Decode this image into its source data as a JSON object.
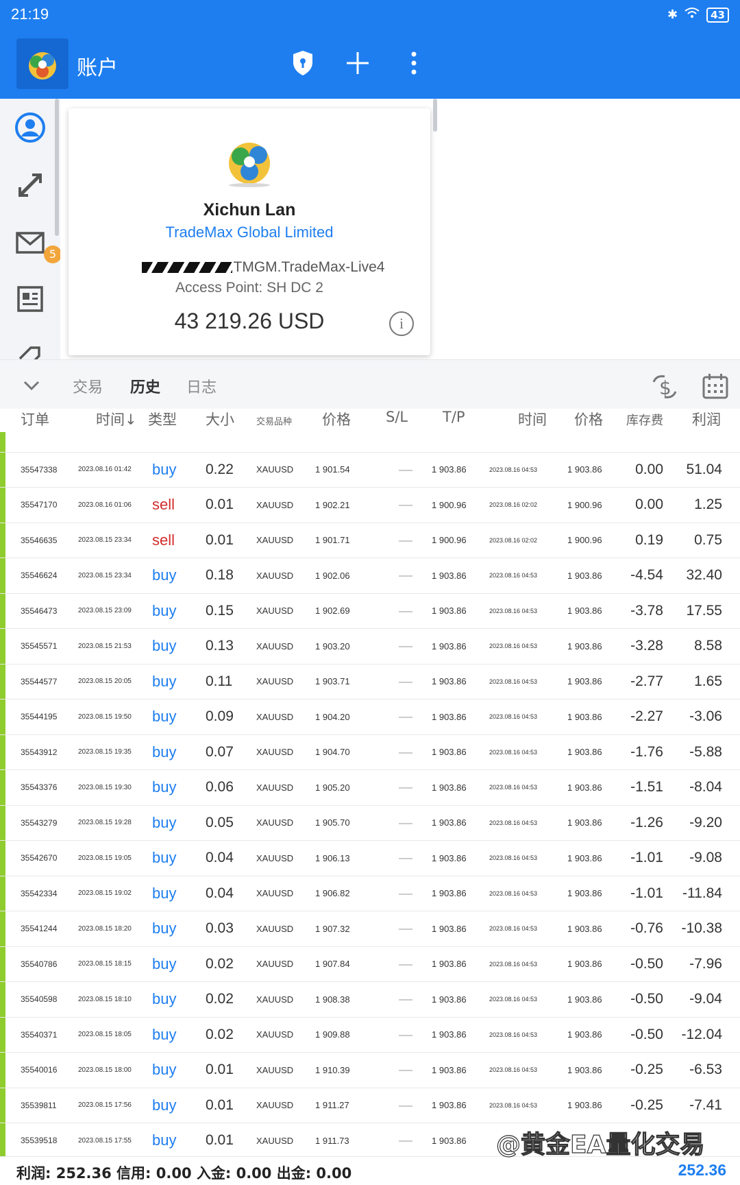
{
  "status": {
    "time": "21:19",
    "battery": "43"
  },
  "app": {
    "title": "账户"
  },
  "account": {
    "name": "Xichun Lan",
    "broker": "TradeMax Global Limited",
    "server": "TMGM.TradeMax-Live4",
    "access_point": "Access Point: SH DC 2",
    "balance": "43 219.26 USD"
  },
  "rail": {
    "mail_badge": "5"
  },
  "tabs": {
    "trade": "交易",
    "history": "历史",
    "journal": "日志"
  },
  "columns": {
    "order": "订单",
    "time": "时间↓",
    "type": "类型",
    "volume": "大小",
    "symbol": "交易品种",
    "price": "价格",
    "sl": "S/L",
    "tp": "T/P",
    "close_time": "时间",
    "close_price": "价格",
    "swap": "库存费",
    "profit": "利润"
  },
  "rows": [
    {
      "order": "35547338",
      "time": "2023.08.16 01:42",
      "type": "buy",
      "volume": "0.22",
      "symbol": "XAUUSD",
      "price": "1 901.54",
      "tp": "1 903.86",
      "close_time": "2023.08.16 04:53",
      "close_price": "1 903.86",
      "swap": "0.00",
      "profit": "51.04"
    },
    {
      "order": "35547170",
      "time": "2023.08.16 01:06",
      "type": "sell",
      "volume": "0.01",
      "symbol": "XAUUSD",
      "price": "1 902.21",
      "tp": "1 900.96",
      "close_time": "2023.08.16 02:02",
      "close_price": "1 900.96",
      "swap": "0.00",
      "profit": "1.25"
    },
    {
      "order": "35546635",
      "time": "2023.08.15 23:34",
      "type": "sell",
      "volume": "0.01",
      "symbol": "XAUUSD",
      "price": "1 901.71",
      "tp": "1 900.96",
      "close_time": "2023.08.16 02:02",
      "close_price": "1 900.96",
      "swap": "0.19",
      "profit": "0.75"
    },
    {
      "order": "35546624",
      "time": "2023.08.15 23:34",
      "type": "buy",
      "volume": "0.18",
      "symbol": "XAUUSD",
      "price": "1 902.06",
      "tp": "1 903.86",
      "close_time": "2023.08.16 04:53",
      "close_price": "1 903.86",
      "swap": "-4.54",
      "profit": "32.40"
    },
    {
      "order": "35546473",
      "time": "2023.08.15 23:09",
      "type": "buy",
      "volume": "0.15",
      "symbol": "XAUUSD",
      "price": "1 902.69",
      "tp": "1 903.86",
      "close_time": "2023.08.16 04:53",
      "close_price": "1 903.86",
      "swap": "-3.78",
      "profit": "17.55"
    },
    {
      "order": "35545571",
      "time": "2023.08.15 21:53",
      "type": "buy",
      "volume": "0.13",
      "symbol": "XAUUSD",
      "price": "1 903.20",
      "tp": "1 903.86",
      "close_time": "2023.08.16 04:53",
      "close_price": "1 903.86",
      "swap": "-3.28",
      "profit": "8.58"
    },
    {
      "order": "35544577",
      "time": "2023.08.15 20:05",
      "type": "buy",
      "volume": "0.11",
      "symbol": "XAUUSD",
      "price": "1 903.71",
      "tp": "1 903.86",
      "close_time": "2023.08.16 04:53",
      "close_price": "1 903.86",
      "swap": "-2.77",
      "profit": "1.65"
    },
    {
      "order": "35544195",
      "time": "2023.08.15 19:50",
      "type": "buy",
      "volume": "0.09",
      "symbol": "XAUUSD",
      "price": "1 904.20",
      "tp": "1 903.86",
      "close_time": "2023.08.16 04:53",
      "close_price": "1 903.86",
      "swap": "-2.27",
      "profit": "-3.06"
    },
    {
      "order": "35543912",
      "time": "2023.08.15 19:35",
      "type": "buy",
      "volume": "0.07",
      "symbol": "XAUUSD",
      "price": "1 904.70",
      "tp": "1 903.86",
      "close_time": "2023.08.16 04:53",
      "close_price": "1 903.86",
      "swap": "-1.76",
      "profit": "-5.88"
    },
    {
      "order": "35543376",
      "time": "2023.08.15 19:30",
      "type": "buy",
      "volume": "0.06",
      "symbol": "XAUUSD",
      "price": "1 905.20",
      "tp": "1 903.86",
      "close_time": "2023.08.16 04:53",
      "close_price": "1 903.86",
      "swap": "-1.51",
      "profit": "-8.04"
    },
    {
      "order": "35543279",
      "time": "2023.08.15 19:28",
      "type": "buy",
      "volume": "0.05",
      "symbol": "XAUUSD",
      "price": "1 905.70",
      "tp": "1 903.86",
      "close_time": "2023.08.16 04:53",
      "close_price": "1 903.86",
      "swap": "-1.26",
      "profit": "-9.20"
    },
    {
      "order": "35542670",
      "time": "2023.08.15 19:05",
      "type": "buy",
      "volume": "0.04",
      "symbol": "XAUUSD",
      "price": "1 906.13",
      "tp": "1 903.86",
      "close_time": "2023.08.16 04:53",
      "close_price": "1 903.86",
      "swap": "-1.01",
      "profit": "-9.08"
    },
    {
      "order": "35542334",
      "time": "2023.08.15 19:02",
      "type": "buy",
      "volume": "0.04",
      "symbol": "XAUUSD",
      "price": "1 906.82",
      "tp": "1 903.86",
      "close_time": "2023.08.16 04:53",
      "close_price": "1 903.86",
      "swap": "-1.01",
      "profit": "-11.84"
    },
    {
      "order": "35541244",
      "time": "2023.08.15 18:20",
      "type": "buy",
      "volume": "0.03",
      "symbol": "XAUUSD",
      "price": "1 907.32",
      "tp": "1 903.86",
      "close_time": "2023.08.16 04:53",
      "close_price": "1 903.86",
      "swap": "-0.76",
      "profit": "-10.38"
    },
    {
      "order": "35540786",
      "time": "2023.08.15 18:15",
      "type": "buy",
      "volume": "0.02",
      "symbol": "XAUUSD",
      "price": "1 907.84",
      "tp": "1 903.86",
      "close_time": "2023.08.16 04:53",
      "close_price": "1 903.86",
      "swap": "-0.50",
      "profit": "-7.96"
    },
    {
      "order": "35540598",
      "time": "2023.08.15 18:10",
      "type": "buy",
      "volume": "0.02",
      "symbol": "XAUUSD",
      "price": "1 908.38",
      "tp": "1 903.86",
      "close_time": "2023.08.16 04:53",
      "close_price": "1 903.86",
      "swap": "-0.50",
      "profit": "-9.04"
    },
    {
      "order": "35540371",
      "time": "2023.08.15 18:05",
      "type": "buy",
      "volume": "0.02",
      "symbol": "XAUUSD",
      "price": "1 909.88",
      "tp": "1 903.86",
      "close_time": "2023.08.16 04:53",
      "close_price": "1 903.86",
      "swap": "-0.50",
      "profit": "-12.04"
    },
    {
      "order": "35540016",
      "time": "2023.08.15 18:00",
      "type": "buy",
      "volume": "0.01",
      "symbol": "XAUUSD",
      "price": "1 910.39",
      "tp": "1 903.86",
      "close_time": "2023.08.16 04:53",
      "close_price": "1 903.86",
      "swap": "-0.25",
      "profit": "-6.53"
    },
    {
      "order": "35539811",
      "time": "2023.08.15 17:56",
      "type": "buy",
      "volume": "0.01",
      "symbol": "XAUUSD",
      "price": "1 911.27",
      "tp": "1 903.86",
      "close_time": "2023.08.16 04:53",
      "close_price": "1 903.86",
      "swap": "-0.25",
      "profit": "-7.41"
    },
    {
      "order": "35539518",
      "time": "2023.08.15 17:55",
      "type": "buy",
      "volume": "0.01",
      "symbol": "XAUUSD",
      "price": "1 911.73",
      "tp": "1 903.86",
      "close_time": "",
      "close_price": "",
      "swap": "",
      "profit": ""
    }
  ],
  "footer": {
    "summary": "利润: 252.36  信用: 0.00  入金: 0.00  出金: 0.00",
    "total": "252.36"
  },
  "watermark": "@黄金EA量化交易",
  "colors": {
    "accent": "#1e7ef0",
    "sell": "#d22d2d",
    "row_marker": "#8fcd2e"
  }
}
